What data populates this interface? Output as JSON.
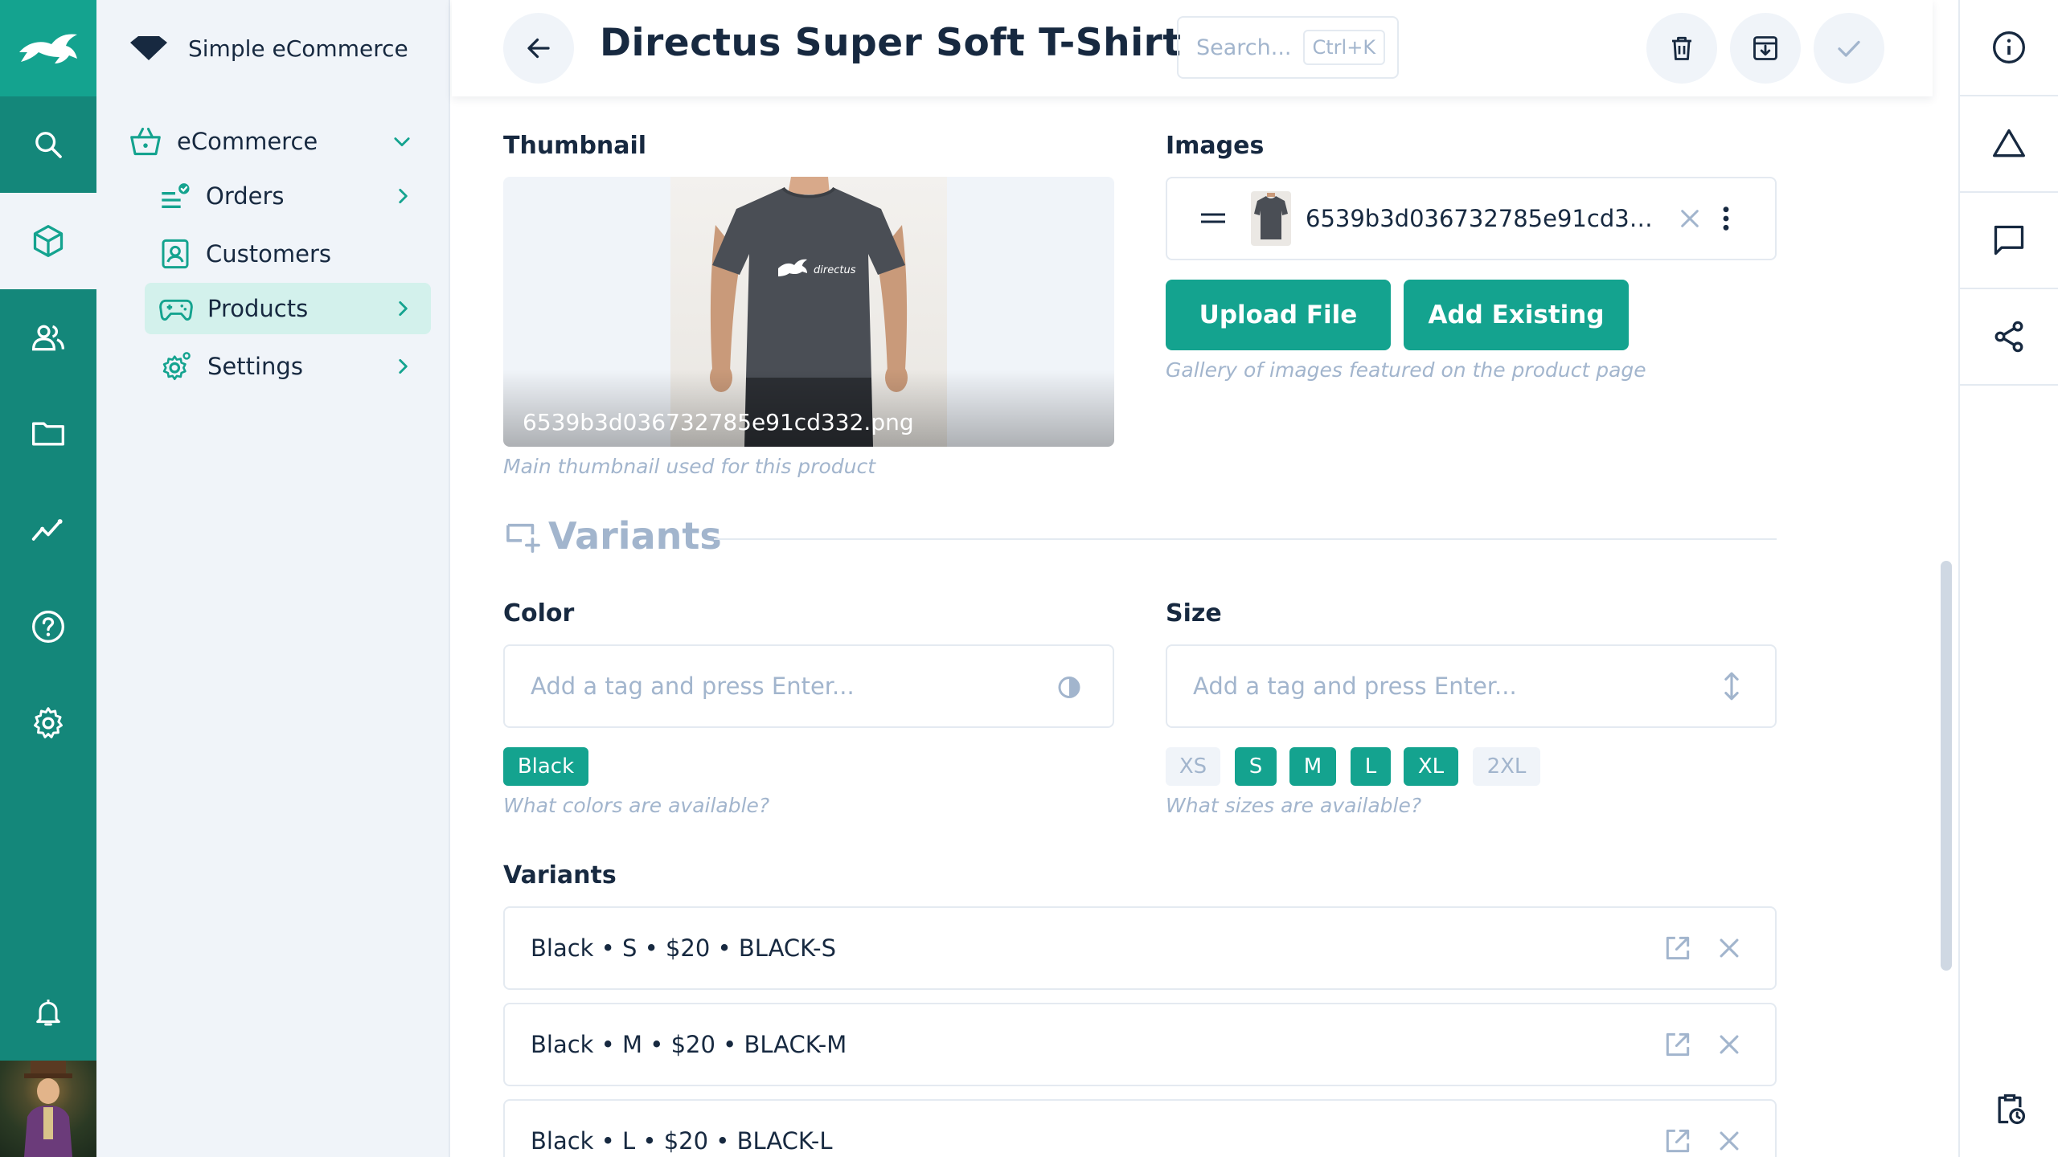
{
  "project": {
    "name": "Simple eCommerce"
  },
  "nav": {
    "group_label": "eCommerce",
    "items": [
      {
        "label": "Orders"
      },
      {
        "label": "Customers"
      },
      {
        "label": "Products"
      },
      {
        "label": "Settings"
      }
    ]
  },
  "header": {
    "title": "Directus Super Soft T-Shirt",
    "search_placeholder": "Search...",
    "search_shortcut": "Ctrl+K"
  },
  "thumbnail": {
    "label": "Thumbnail",
    "filename": "6539b3d036732785e91cd332.png",
    "note": "Main thumbnail used for this product",
    "shirt_logo_text": "directus"
  },
  "images": {
    "label": "Images",
    "item_name": "6539b3d036732785e91cd33...",
    "upload_label": "Upload File",
    "add_existing_label": "Add Existing",
    "note": "Gallery of images featured on the product page"
  },
  "variants_divider": {
    "title": "Variants"
  },
  "color": {
    "label": "Color",
    "placeholder": "Add a tag and press Enter...",
    "tags": [
      "Black"
    ],
    "note": "What colors are available?"
  },
  "size": {
    "label": "Size",
    "placeholder": "Add a tag and press Enter...",
    "options": [
      {
        "label": "XS",
        "selected": false
      },
      {
        "label": "S",
        "selected": true
      },
      {
        "label": "M",
        "selected": true
      },
      {
        "label": "L",
        "selected": true
      },
      {
        "label": "XL",
        "selected": true
      },
      {
        "label": "2XL",
        "selected": false
      }
    ],
    "note": "What sizes are available?"
  },
  "variants": {
    "label": "Variants",
    "items": [
      "Black • S • $20 • BLACK-S",
      "Black • M • $20 • BLACK-M",
      "Black • L • $20 • BLACK-L"
    ]
  },
  "colors": {
    "primary": "#14a38f",
    "module_bar": "#14877a",
    "text": "#172940",
    "muted": "#a2b5cd",
    "border": "#e4eaf1",
    "subtle_bg": "#f0f4f9",
    "active_nav": "#d3f1ec"
  }
}
